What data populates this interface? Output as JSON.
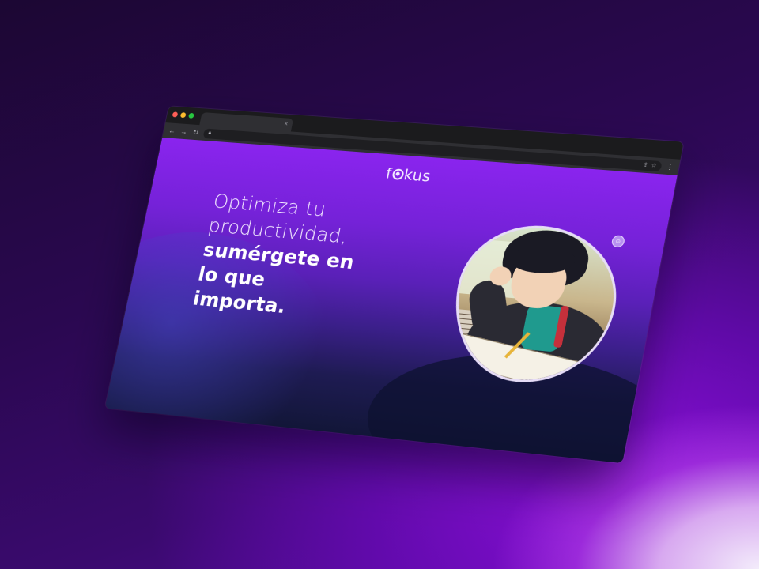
{
  "browser": {
    "tab_title": "",
    "tab_close": "×",
    "address": "",
    "icons": {
      "back": "←",
      "forward": "→",
      "reload": "↻",
      "lock": "🔒︎",
      "share": "⇪",
      "bookmark": "☆",
      "menu": "⋮"
    }
  },
  "site": {
    "logo_prefix": "f",
    "logo_suffix": "kus",
    "hero": {
      "line1": "Optimiza tu",
      "line2": "productividad,",
      "line3": "sumérgete en",
      "line4": "lo que",
      "line5": "importa."
    },
    "assist_icon": "☺",
    "colors": {
      "accent": "#8a24ee",
      "deep": "#121638"
    }
  }
}
